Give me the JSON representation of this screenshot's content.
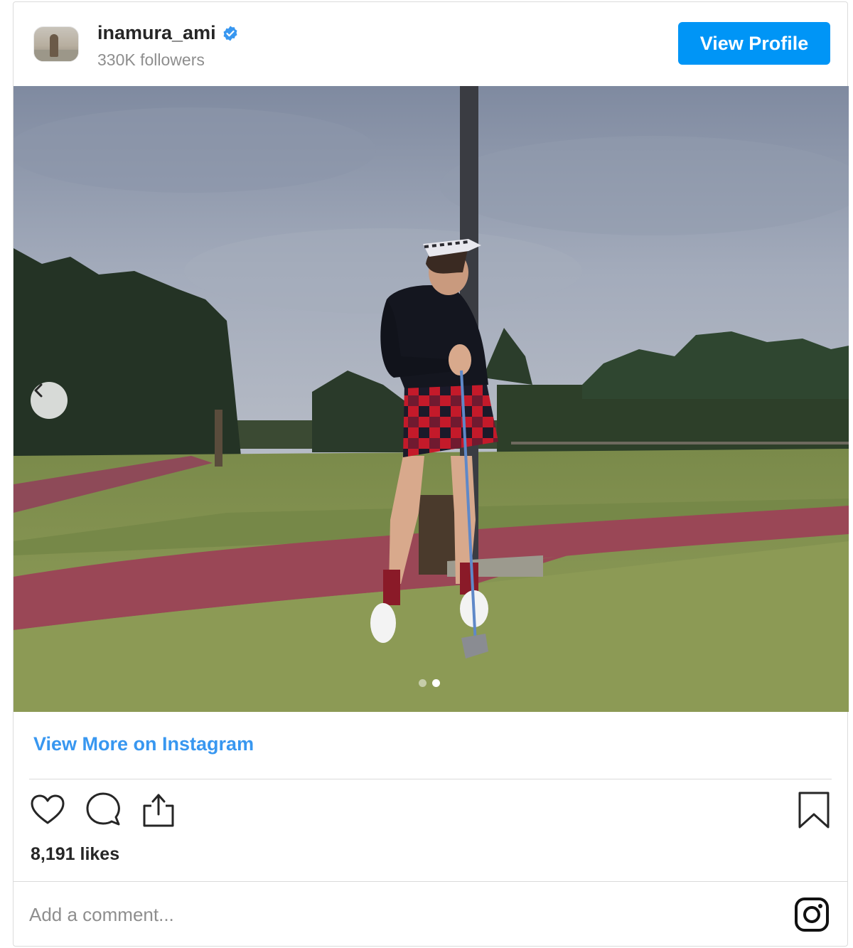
{
  "header": {
    "username": "inamura_ami",
    "verified": true,
    "followers": "330K followers",
    "view_profile_label": "View Profile"
  },
  "photo": {
    "icons": {
      "prev": "chevron-left-icon"
    },
    "carousel": {
      "count": 2,
      "active_index": 1
    }
  },
  "footer": {
    "view_more_label": "View More on Instagram",
    "likes": "8,191 likes",
    "comment_placeholder": "Add a comment...",
    "icons": {
      "like": "heart-icon",
      "comment": "comment-icon",
      "share": "share-icon",
      "save": "bookmark-icon",
      "brand": "instagram-icon"
    }
  },
  "colors": {
    "accent": "#0095f6",
    "link": "#3897f0",
    "verified": "#3897f0"
  }
}
